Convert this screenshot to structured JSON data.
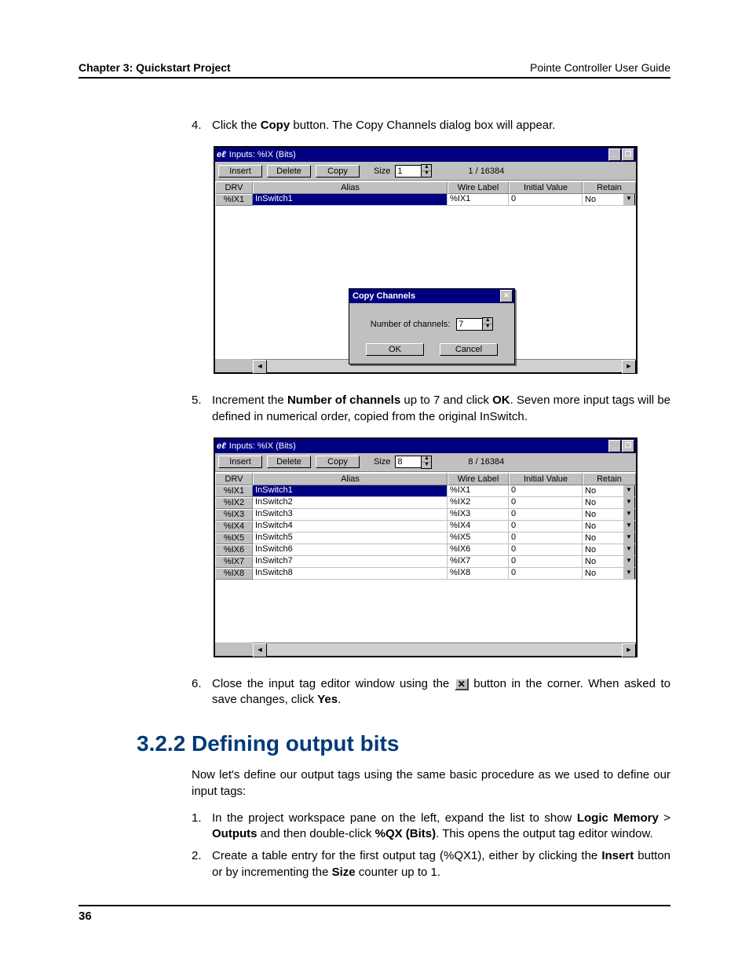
{
  "header": {
    "chapter": "Chapter 3: Quickstart Project",
    "guide": "Pointe Controller User Guide"
  },
  "step4": {
    "num": "4.",
    "pre": "Click the ",
    "bold": "Copy",
    "post": " button. The Copy Channels dialog box will appear."
  },
  "win1": {
    "title": "Inputs: %IX (Bits)",
    "buttons": {
      "insert": "Insert",
      "delete": "Delete",
      "copy": "Copy"
    },
    "size_label": "Size",
    "size_value": "1",
    "ratio": "1 / 16384",
    "headers": {
      "drv": "DRV",
      "alias": "Alias",
      "wire": "Wire Label",
      "init": "Initial Value",
      "retain": "Retain"
    },
    "row": {
      "drv": "%IX1",
      "alias": "InSwitch1",
      "wire": "%IX1",
      "init": "0",
      "retain": "No"
    }
  },
  "modal": {
    "title": "Copy Channels",
    "label": "Number of channels:",
    "value": "7",
    "ok": "OK",
    "cancel": "Cancel"
  },
  "step5": {
    "num": "5.",
    "t1": "Increment the ",
    "b1": "Number of channels",
    "t2": " up to 7 and click ",
    "b2": "OK",
    "t3": ". Seven more input tags will be defined in numerical order, copied from the original InSwitch."
  },
  "win2": {
    "title": "Inputs: %IX (Bits)",
    "buttons": {
      "insert": "Insert",
      "delete": "Delete",
      "copy": "Copy"
    },
    "size_label": "Size",
    "size_value": "8",
    "ratio": "8 / 16384",
    "headers": {
      "drv": "DRV",
      "alias": "Alias",
      "wire": "Wire Label",
      "init": "Initial Value",
      "retain": "Retain"
    },
    "rows": [
      {
        "drv": "%IX1",
        "alias": "InSwitch1",
        "wire": "%IX1",
        "init": "0",
        "retain": "No"
      },
      {
        "drv": "%IX2",
        "alias": "InSwitch2",
        "wire": "%IX2",
        "init": "0",
        "retain": "No"
      },
      {
        "drv": "%IX3",
        "alias": "InSwitch3",
        "wire": "%IX3",
        "init": "0",
        "retain": "No"
      },
      {
        "drv": "%IX4",
        "alias": "InSwitch4",
        "wire": "%IX4",
        "init": "0",
        "retain": "No"
      },
      {
        "drv": "%IX5",
        "alias": "InSwitch5",
        "wire": "%IX5",
        "init": "0",
        "retain": "No"
      },
      {
        "drv": "%IX6",
        "alias": "InSwitch6",
        "wire": "%IX6",
        "init": "0",
        "retain": "No"
      },
      {
        "drv": "%IX7",
        "alias": "InSwitch7",
        "wire": "%IX7",
        "init": "0",
        "retain": "No"
      },
      {
        "drv": "%IX8",
        "alias": "InSwitch8",
        "wire": "%IX8",
        "init": "0",
        "retain": "No"
      }
    ]
  },
  "step6": {
    "num": "6.",
    "t1": "Close the input tag editor window using the ",
    "t2": " button in the corner. When asked to save changes, click ",
    "b2": "Yes",
    "t3": "."
  },
  "heading": {
    "num": "3.2.2",
    "title": "Defining output bits"
  },
  "intro": "Now let's define our output tags using the same basic procedure as we used to define our input tags:",
  "ostep1": {
    "num": "1.",
    "t1": "In the project workspace pane on the left, expand the list to show ",
    "b1": "Logic Memory",
    "t2": " > ",
    "b2": "Outputs",
    "t3": " and then double-click ",
    "b3": "%QX (Bits)",
    "t4": ". This opens the output tag editor window."
  },
  "ostep2": {
    "num": "2.",
    "t1": "Create a table entry for the first output tag (%QX1), either by clicking the ",
    "b1": "Insert",
    "t2": " button or by incrementing the ",
    "b2": "Size",
    "t3": " counter up to 1."
  },
  "footer": {
    "page": "36"
  },
  "glyph": {
    "x": "✕",
    "min": "_",
    "max": "❐",
    "up": "▲",
    "down": "▼",
    "left": "◄",
    "right": "►"
  }
}
